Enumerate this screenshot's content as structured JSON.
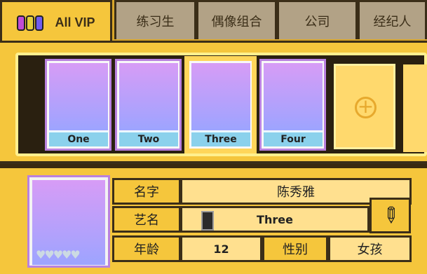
{
  "tabs": [
    "All VIP",
    "练习生",
    "偶像组合",
    "公司",
    "经纪人"
  ],
  "cards": [
    {
      "name": "One",
      "icon": "blue-bow-idol-icon"
    },
    {
      "name": "Two",
      "icon": "black-hat-idol-icon"
    },
    {
      "name": "Three",
      "icon": "white-dress-idol-icon"
    },
    {
      "name": "Four",
      "icon": "red-rose-idol-icon"
    }
  ],
  "details": {
    "name_label": "名字",
    "name_value": "陈秀雅",
    "stage_label": "艺名",
    "stage_value": "Three",
    "age_label": "年龄",
    "age_value": "12",
    "gender_label": "性别",
    "gender_value": "女孩"
  },
  "colors": {
    "gold": "#f5c63c",
    "light_gold": "#ffe08f",
    "dark_border": "#3b2e18",
    "card_name_bg": "#8bd1ec"
  }
}
